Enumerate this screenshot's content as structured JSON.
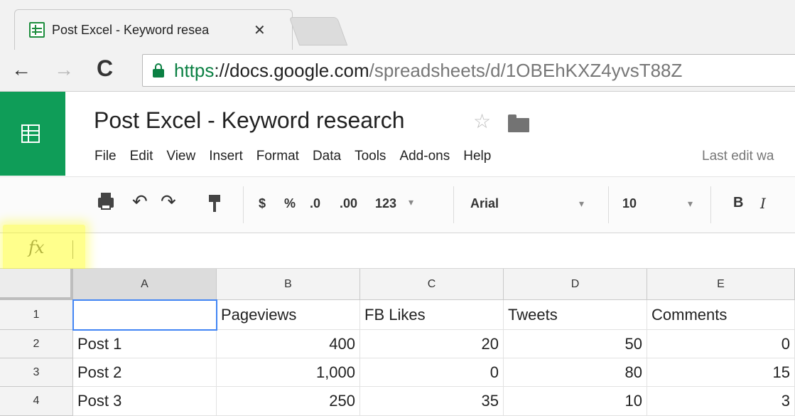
{
  "browser": {
    "tab_title": "Post Excel - Keyword resea",
    "tab_close": "✕",
    "nav": {
      "back": "←",
      "forward": "→",
      "reload": "C"
    },
    "url": {
      "scheme": "https",
      "separator": "://",
      "host": "docs.google.com",
      "path": "/spreadsheets/d/1OBEhKXZ4yvsT88Z"
    }
  },
  "doc": {
    "title": "Post Excel - Keyword research",
    "star": "☆",
    "menus": [
      "File",
      "Edit",
      "View",
      "Insert",
      "Format",
      "Data",
      "Tools",
      "Add-ons",
      "Help"
    ],
    "last_edit": "Last edit wa"
  },
  "toolbar": {
    "undo": "↶",
    "redo": "↷",
    "currency": "$",
    "percent": "%",
    "decrease_decimal": ".0",
    "increase_decimal": ".00",
    "number_format": "123",
    "font_family": "Arial",
    "font_size": "10",
    "dropdown_arrow": "▾",
    "bold": "B",
    "italic": "I"
  },
  "formula_bar": {
    "fx_label": "fx",
    "value": ""
  },
  "sheet": {
    "columns": [
      "A",
      "B",
      "C",
      "D",
      "E"
    ],
    "rows": [
      {
        "num": "1",
        "cells": [
          "",
          "Pageviews",
          "FB Likes",
          "Tweets",
          "Comments"
        ]
      },
      {
        "num": "2",
        "cells": [
          "Post 1",
          "400",
          "20",
          "50",
          "0"
        ]
      },
      {
        "num": "3",
        "cells": [
          "Post 2",
          "1,000",
          "0",
          "80",
          "15"
        ]
      },
      {
        "num": "4",
        "cells": [
          "Post 3",
          "250",
          "35",
          "10",
          "3"
        ]
      }
    ]
  },
  "colors": {
    "sheets_green": "#0f9d58",
    "secure_green": "#0b8043",
    "active_cell_border": "#4285f4",
    "highlight": "#ffff00"
  }
}
